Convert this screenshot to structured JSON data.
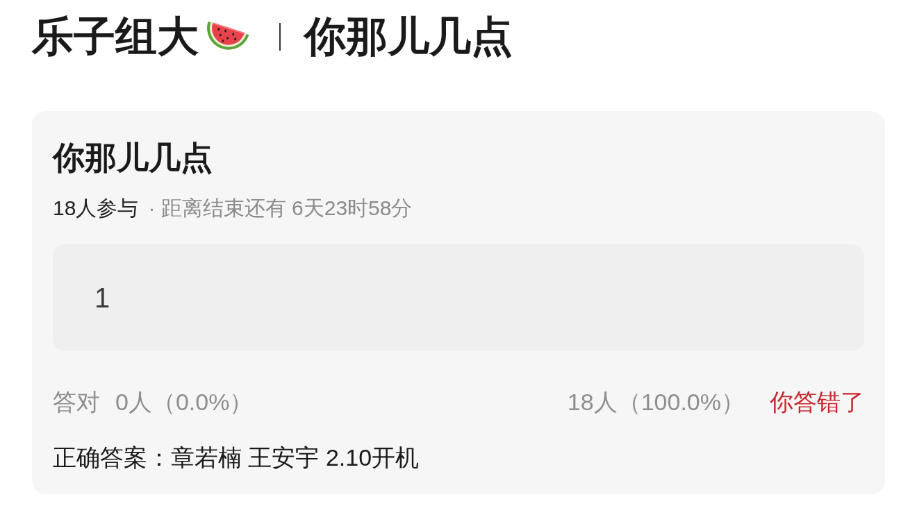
{
  "header": {
    "group_name": "乐子组大",
    "title": "你那儿几点"
  },
  "card": {
    "title": "你那儿几点",
    "participants": "18人参与",
    "countdown": "· 距离结束还有 6天23时58分",
    "answer": {
      "value": "1"
    },
    "stats": {
      "correct_label": "答对",
      "correct_count": "0人（0.0%）",
      "wrong_count": "18人（100.0%）",
      "verdict": "你答错了"
    },
    "correct_answer": "正确答案：章若楠 王安宇 2.10开机"
  }
}
